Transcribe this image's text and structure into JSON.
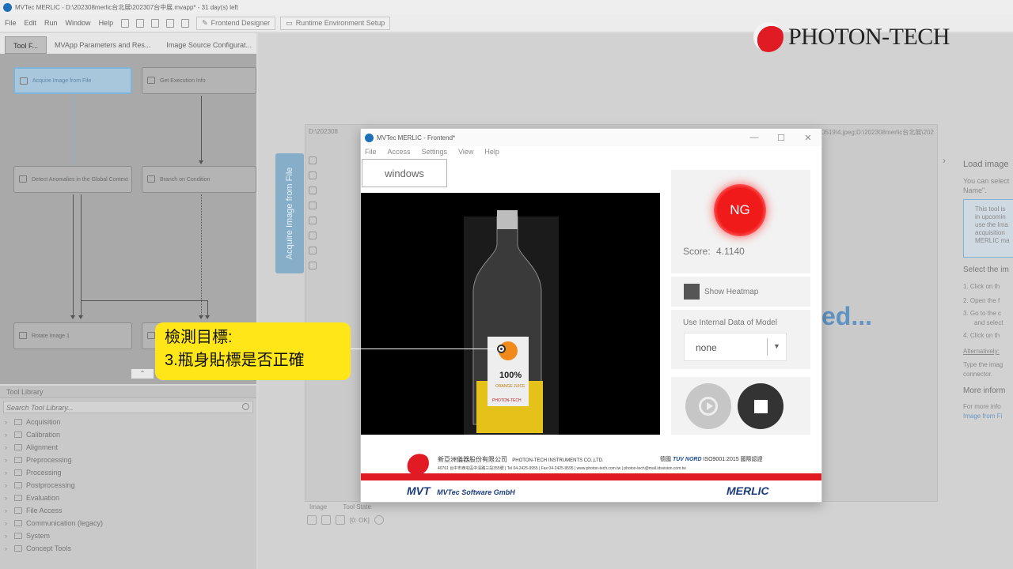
{
  "titlebar": {
    "text": "MVTec MERLIC - D:\\202308merlic台北展\\202307台中展.mvapp* - 31 day(s) left"
  },
  "menubar": {
    "items": [
      "File",
      "Edit",
      "Run",
      "Window",
      "Help"
    ],
    "frontend_designer": "Frontend Designer",
    "runtime_setup": "Runtime Environment Setup"
  },
  "left_tabs": [
    "Tool F...",
    "MVApp Parameters and Res...",
    "Image Source Configurat..."
  ],
  "flow": {
    "nodes": {
      "acquire": "Acquire Image from File",
      "exec_info": "Get Execution Info",
      "anomalies": "Detect Anomalies in the Global Context",
      "branch": "Branch on Condition",
      "rotate": "Rotate Image 1"
    }
  },
  "tool_library": {
    "header": "Tool Library",
    "search_placeholder": "Search Tool Library...",
    "categories": [
      "Acquisition",
      "Calibration",
      "Alignment",
      "Preprocessing",
      "Processing",
      "Postprocessing",
      "Evaluation",
      "File Access",
      "Communication (legacy)",
      "System",
      "Concept Tools"
    ]
  },
  "main": {
    "vertical_tab": "Acquire Image from File",
    "path": "D:\\202308",
    "path_right": "北展\\20230519\\4.jpeg;D:\\202308merlic台北展\\2023051",
    "bg_text": "ed...",
    "bottom_labels": [
      "Image",
      "Tool State"
    ],
    "tool_state_value": "[0: OK]"
  },
  "right_panel": {
    "heading": "Load image",
    "line1": "You can select",
    "line2": "Name\".",
    "info": [
      "This tool is",
      "in upcomin",
      "use the Ima",
      "acquisition",
      "MERLIC ma"
    ],
    "select_heading": "Select the im",
    "steps": [
      "1. Click on th",
      "2. Open the f",
      "3. Go to the c",
      "and select",
      "4. Click on th"
    ],
    "alternatively": "Alternatively:",
    "type_line1": "Type the imag",
    "type_line2": "connector.",
    "more_heading": "More inform",
    "more_line": "For more info",
    "more_link": "Image from Fi"
  },
  "brand": {
    "name": "PHOTON-TECH"
  },
  "frontend": {
    "title": "MVTec MERLIC - Frontend*",
    "menu": [
      "File",
      "Access",
      "Settings",
      "View",
      "Help"
    ],
    "windows_button": "windows",
    "result": "NG",
    "score_label": "Score:",
    "score_value": "4.1140",
    "heatmap_label": "Show Heatmap",
    "model_label": "Use Internal Data of Model",
    "model_value": "none",
    "footer": {
      "company_zh": "新亞洲儀器股份有限公司",
      "company_en": "PHOTON-TECH INSTRUMENTS CO.,LTD.",
      "cert_prefix": "德國",
      "cert_brand": "TUV NORD",
      "cert_iso": "ISO9001:2015 國際認證",
      "address": "40761 台中市西屯區中清路三段355號 | Tel 04-2425-9955 | Fax 04-2425-9595 | www.photon-tech.com.tw | photon-tech@mail.idsvision.com.tw",
      "mvtec": "MVTec Software GmbH",
      "merlic": "MERLIC"
    }
  },
  "callout": {
    "line1": "檢測目標:",
    "line2": "3.瓶身貼標是否正確"
  },
  "bottle_label": {
    "line1": "100%",
    "line2": "ORANGE JUICE",
    "line3": "PHOTON-TECH"
  },
  "colors": {
    "accent": "#86aec9",
    "ng": "#f11a1a",
    "callout": "#ffe619",
    "brand_red": "#e01b24"
  }
}
